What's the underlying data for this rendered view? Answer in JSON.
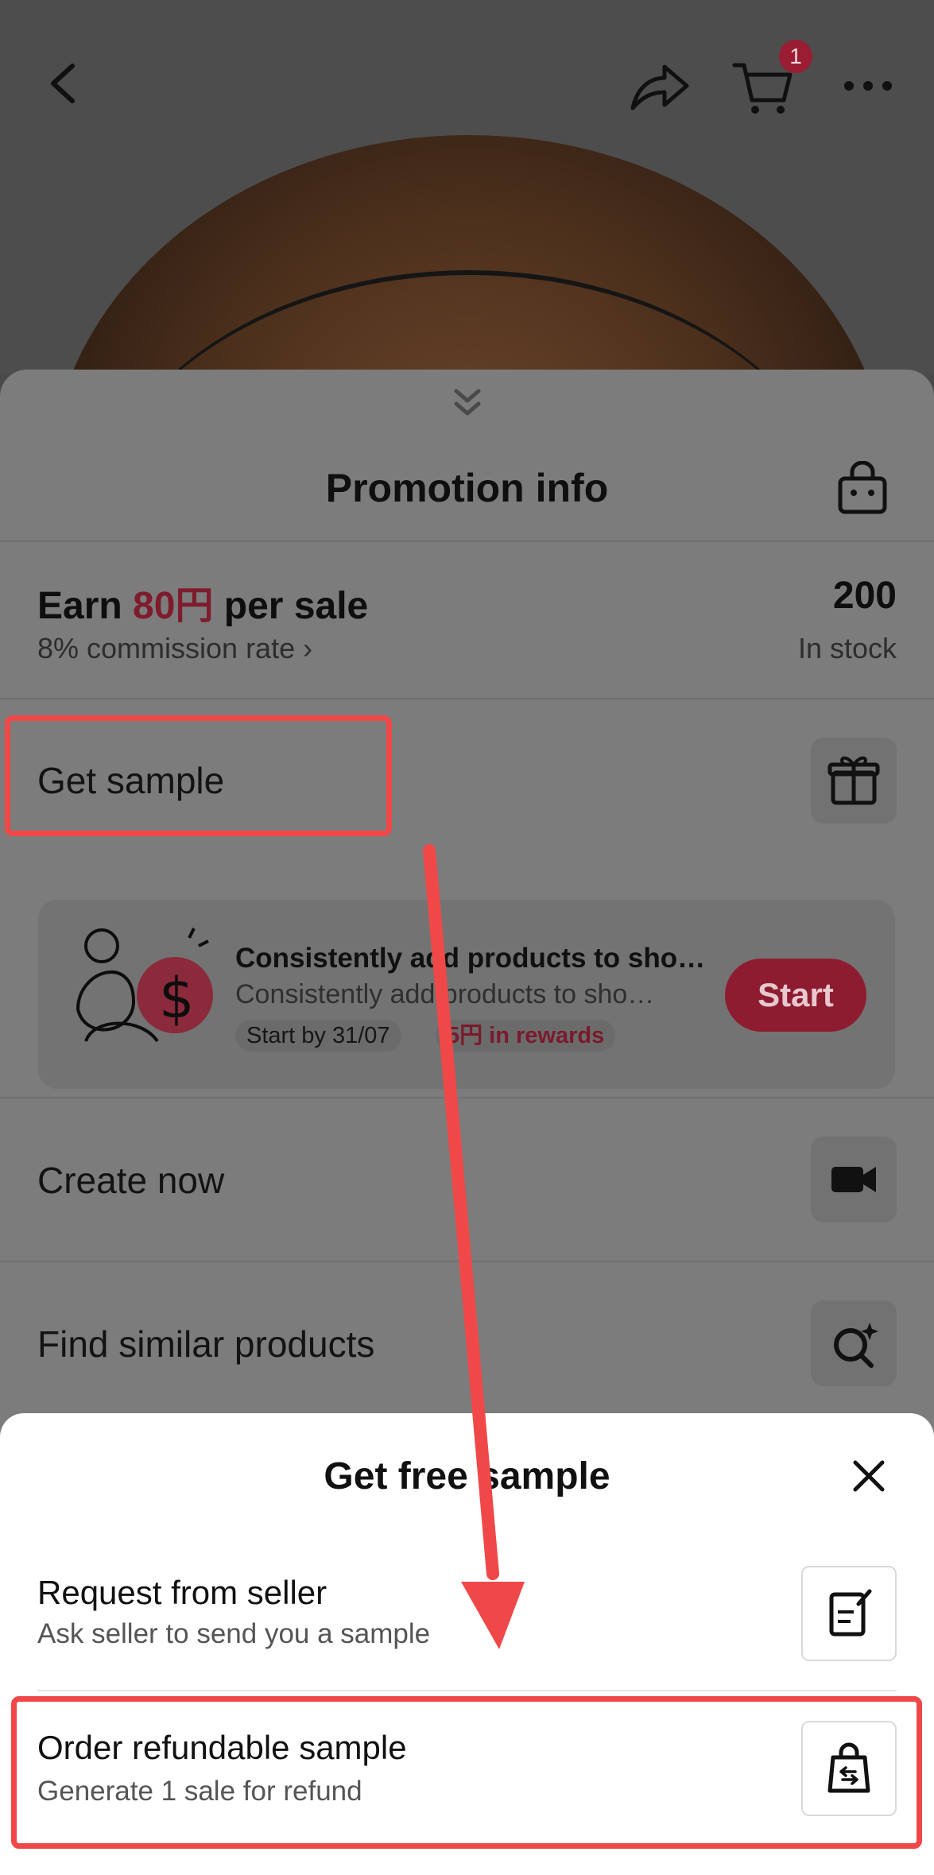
{
  "header": {
    "cart_count": "1",
    "icons": [
      "back-arrow-icon",
      "share-icon",
      "cart-icon",
      "more-icon"
    ]
  },
  "promotion": {
    "title": "Promotion info",
    "earn_prefix": "Earn ",
    "earn_amount": "80円",
    "earn_suffix": " per sale",
    "commission": "8% commission rate",
    "stock_count": "200",
    "stock_label": "In stock",
    "get_sample": "Get sample",
    "task": {
      "title": "Consistently add products to sho…",
      "subtitle": "Consistently add products to sho…",
      "start_by": "Start by 31/07",
      "rewards": "5円 in rewards",
      "start_button": "Start"
    },
    "create_now": "Create now",
    "find_similar": "Find similar products"
  },
  "sheet": {
    "title": "Get free sample",
    "options": [
      {
        "title": "Request from seller",
        "subtitle": "Ask seller to send you a sample"
      },
      {
        "title": "Order refundable sample",
        "subtitle": "Generate 1 sale for refund"
      }
    ]
  },
  "colors": {
    "accent": "#f04848",
    "brand_red": "#e0243f"
  }
}
